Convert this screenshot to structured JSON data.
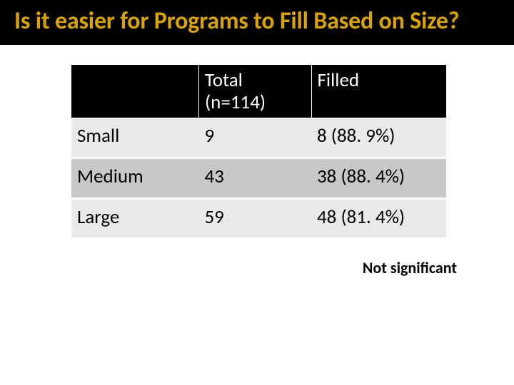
{
  "title": "Is it easier for Programs to Fill Based on Size?",
  "chart_data": {
    "type": "table",
    "columns": [
      "",
      "Total (n=114)",
      "Filled"
    ],
    "rows": [
      {
        "label": "Small",
        "total": "9",
        "filled": "8 (88. 9%)"
      },
      {
        "label": "Medium",
        "total": "43",
        "filled": "38 (88. 4%)"
      },
      {
        "label": "Large",
        "total": "59",
        "filled": "48 (81. 4%)"
      }
    ]
  },
  "footnote": "Not significant"
}
